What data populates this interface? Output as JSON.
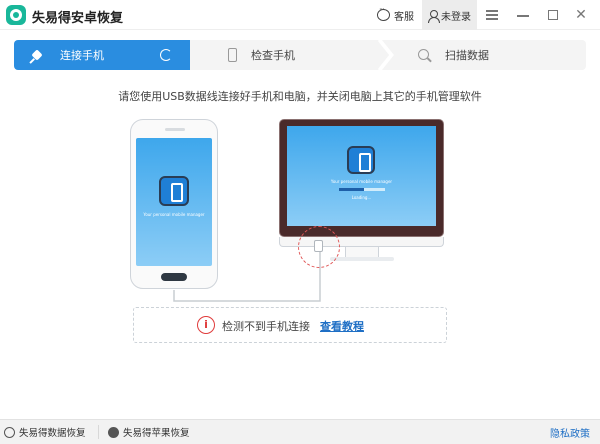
{
  "app": {
    "title": "失易得安卓恢复"
  },
  "titlebar": {
    "service_label": "客服",
    "login_label": "未登录"
  },
  "steps": [
    {
      "label": "连接手机",
      "active": true,
      "icon": "plug-icon"
    },
    {
      "label": "检查手机",
      "active": false,
      "icon": "phone-icon"
    },
    {
      "label": "扫描数据",
      "active": false,
      "icon": "magnifier-icon"
    }
  ],
  "instruction": "请您使用USB数据线连接好手机和电脑，并关闭电脑上其它的手机管理软件",
  "device": {
    "tagline": "Your personal mobile manager",
    "loading": "Loading...",
    "progress": 0.55
  },
  "status": {
    "message": "检测不到手机连接",
    "tutorial_link": "查看教程"
  },
  "footer": {
    "data_recovery": "失易得数据恢复",
    "apple_recovery": "失易得苹果恢复",
    "privacy": "隐私政策"
  },
  "colors": {
    "accent": "#2a8de0",
    "warning": "#e03b3b",
    "link": "#1f6fc5",
    "brand": "#19b79a"
  }
}
